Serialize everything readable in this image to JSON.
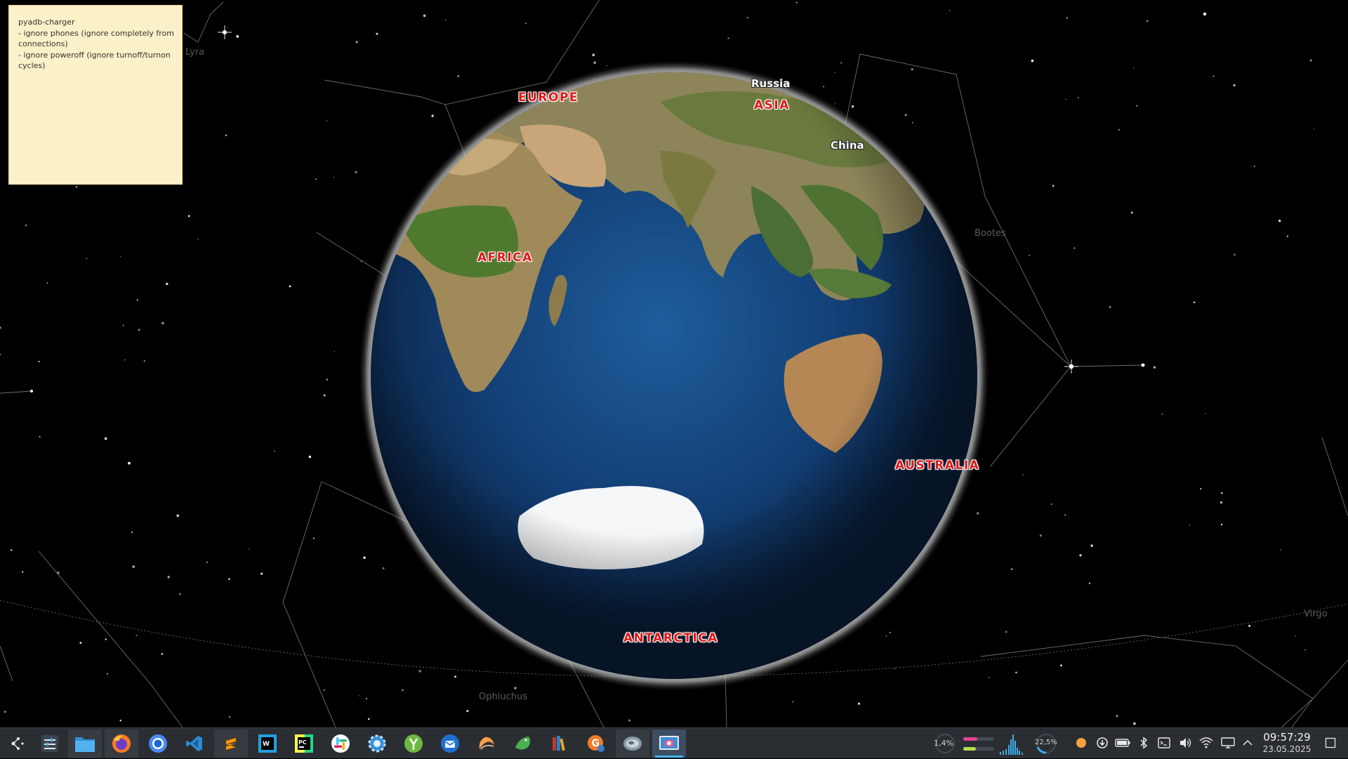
{
  "sky": {
    "constellations": [
      "Lyra",
      "Bootes",
      "Ophiuchus",
      "Virgo"
    ]
  },
  "globe": {
    "continents": [
      "EUROPE",
      "ASIA",
      "AFRICA",
      "AUSTRALIA",
      "ANTARCTICA"
    ],
    "countries": [
      "Russia",
      "China"
    ]
  },
  "note": {
    "text": "pyadb-charger\n- ignore phones (ignore completely from connections)\n- ignore poweroff (ignore turnoff/turnon cycles)"
  },
  "taskbar": {
    "launcher": {
      "icon": "application-launcher-icon"
    },
    "apps": [
      {
        "name": "task-manager",
        "icon": "sliders-icon"
      },
      {
        "name": "file-manager",
        "icon": "folder-icon"
      },
      {
        "name": "firefox",
        "icon": "firefox-icon"
      },
      {
        "name": "chromium",
        "icon": "chromium-icon"
      },
      {
        "name": "vscode",
        "icon": "vscode-icon"
      },
      {
        "name": "sublime-text",
        "icon": "sublime-icon"
      },
      {
        "name": "webstorm",
        "icon": "webstorm-icon"
      },
      {
        "name": "pycharm",
        "icon": "pycharm-icon"
      },
      {
        "name": "slack",
        "icon": "slack-icon"
      },
      {
        "name": "system-settings",
        "icon": "gear-icon"
      },
      {
        "name": "app-y",
        "icon": "y-leaf-icon"
      },
      {
        "name": "thunderbird",
        "icon": "thunderbird-icon"
      },
      {
        "name": "app-peach",
        "icon": "peach-icon"
      },
      {
        "name": "app-gecko",
        "icon": "lizard-icon"
      },
      {
        "name": "library",
        "icon": "books-icon"
      },
      {
        "name": "app-g",
        "icon": "g-badge-icon"
      },
      {
        "name": "marble",
        "icon": "marble-globe-icon"
      },
      {
        "name": "screenshot",
        "icon": "screenshot-icon"
      }
    ],
    "monitors": {
      "cpu_label": "1,4%",
      "disk_label": "22,5%"
    },
    "tray": [
      "weather-icon",
      "updates-icon",
      "battery-icon",
      "bluetooth-icon",
      "terminal-icon",
      "volume-icon",
      "wifi-icon",
      "display-icon",
      "chevron-up-icon"
    ],
    "clock": {
      "time": "09:57:29",
      "date": "23.05.2025"
    },
    "show_desktop_icon": "show-desktop-icon"
  }
}
